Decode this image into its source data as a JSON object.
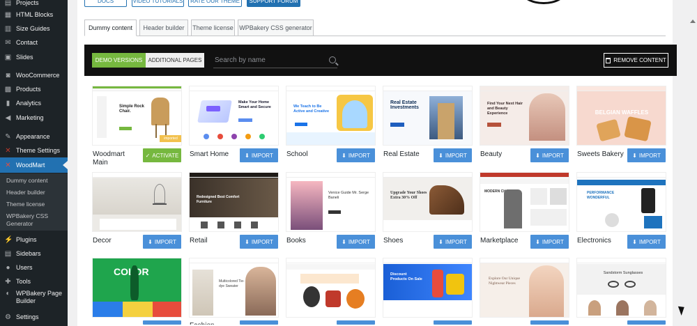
{
  "sidebar": {
    "items": [
      {
        "label": "Projects",
        "icon": "projects-icon"
      },
      {
        "label": "HTML Blocks",
        "icon": "blocks-icon"
      },
      {
        "label": "Size Guides",
        "icon": "table-icon"
      },
      {
        "label": "Contact",
        "icon": "mail-icon"
      },
      {
        "label": "Slides",
        "icon": "slides-icon"
      },
      {
        "label": "WooCommerce",
        "icon": "woo-icon"
      },
      {
        "label": "Products",
        "icon": "box-icon"
      },
      {
        "label": "Analytics",
        "icon": "chart-icon"
      },
      {
        "label": "Marketing",
        "icon": "megaphone-icon"
      },
      {
        "label": "Appearance",
        "icon": "brush-icon"
      },
      {
        "label": "Theme Settings",
        "icon": "settings-icon"
      },
      {
        "label": "WoodMart",
        "icon": "woodmart-icon"
      },
      {
        "label": "Plugins",
        "icon": "plugin-icon"
      },
      {
        "label": "Sidebars",
        "icon": "sidebar-icon"
      },
      {
        "label": "Users",
        "icon": "user-icon"
      },
      {
        "label": "Tools",
        "icon": "wrench-icon"
      },
      {
        "label": "WPBakery Page Builder",
        "icon": "wpbakery-icon"
      },
      {
        "label": "Settings",
        "icon": "gear-icon"
      }
    ],
    "submenu": [
      "Dummy content",
      "Header builder",
      "Theme license",
      "WPBakery CSS Generator"
    ]
  },
  "top_buttons": [
    "DOCS",
    "VIDEO TUTORIALS",
    "RATE OUR THEME",
    "SUPPORT FORUM"
  ],
  "tabs": [
    "Dummy content",
    "Header builder",
    "Theme license",
    "WPBakery CSS generator"
  ],
  "toolbar": {
    "demo_versions": "DEMO VERSIONS",
    "additional_pages": "ADDITIONAL PAGES",
    "search_placeholder": "Search by name",
    "remove_content": "REMOVE CONTENT"
  },
  "cards": [
    {
      "name": "Woodmart Main",
      "button": "ACTIVATE",
      "thumb_title": "Simple Rock Chair.",
      "badge": "imported"
    },
    {
      "name": "Smart Home",
      "button": "IMPORT",
      "thumb_title": "Make Your Home Smart and Secure"
    },
    {
      "name": "School",
      "button": "IMPORT",
      "thumb_title": "We Teach to Be Active and Creative"
    },
    {
      "name": "Real Estate",
      "button": "IMPORT",
      "thumb_title": "Real Estate Investments"
    },
    {
      "name": "Beauty",
      "button": "IMPORT",
      "thumb_title": "Find Your Next Hair and Beauty Experience"
    },
    {
      "name": "Sweets Bakery",
      "button": "IMPORT",
      "thumb_title": "BELGIAN WAFFLES"
    },
    {
      "name": "Decor",
      "button": "IMPORT",
      "thumb_title": ""
    },
    {
      "name": "Retail",
      "button": "IMPORT",
      "thumb_title": "Redesigned Best Comfort Furniture"
    },
    {
      "name": "Books",
      "button": "IMPORT",
      "thumb_title": "Venice Guide Mr. Serge Baneli"
    },
    {
      "name": "Shoes",
      "button": "IMPORT",
      "thumb_title": "Upgrade Your Shoes Extra 30% Off"
    },
    {
      "name": "Marketplace",
      "button": "IMPORT",
      "thumb_title": "MODERN CHAIR"
    },
    {
      "name": "Electronics",
      "button": "IMPORT",
      "thumb_title": "PERFORMANCE WONDERFUL"
    },
    {
      "name": "",
      "button": "",
      "thumb_title": "COLOR"
    },
    {
      "name": "Fashion",
      "button": "",
      "thumb_title": "Multicolored Tie-dye Sweater"
    },
    {
      "name": "",
      "button": "",
      "thumb_title": ""
    },
    {
      "name": "",
      "button": "",
      "thumb_title": "Discount Products On Sale"
    },
    {
      "name": "",
      "button": "",
      "thumb_title": "Explore Our Unique Nightwear Pieces"
    },
    {
      "name": "",
      "button": "",
      "thumb_title": "Sandstorm Sunglasses"
    }
  ],
  "colors": {
    "sidebar_bg": "#1d2327",
    "active_menu": "#2271b1",
    "import_button": "#4a90d9",
    "activate_button": "#76b83f",
    "toolbar_bg": "#111111"
  }
}
